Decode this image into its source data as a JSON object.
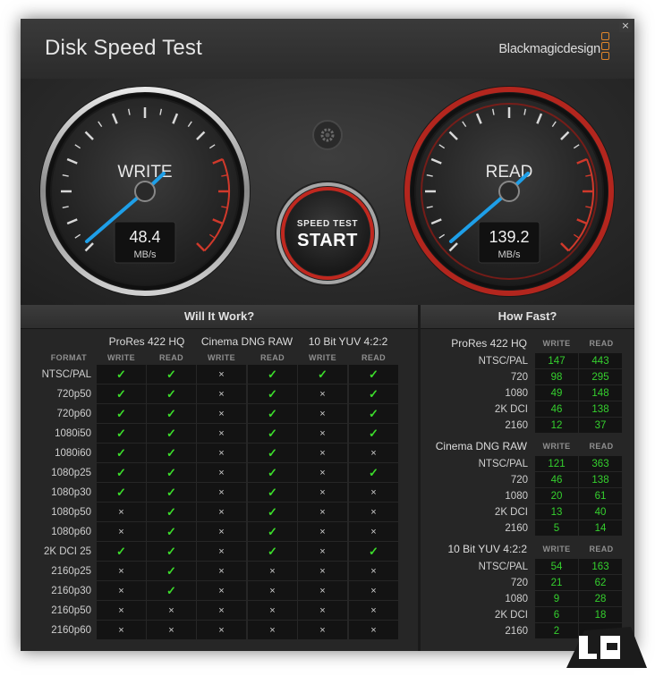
{
  "app": {
    "title": "Disk Speed Test",
    "brand": "Blackmagicdesign",
    "close_glyph": "×",
    "accent_color": "#e0852a"
  },
  "gauges": {
    "write": {
      "label": "WRITE",
      "value": "48.4",
      "unit": "MB/s"
    },
    "read": {
      "label": "READ",
      "value": "139.2",
      "unit": "MB/s"
    },
    "start_button": {
      "line1": "SPEED TEST",
      "line2": "START"
    },
    "settings_icon": "gear-icon"
  },
  "will_it_work": {
    "title": "Will It Work?",
    "format_label": "FORMAT",
    "codecs": [
      {
        "name": "ProRes 422 HQ",
        "write": "WRITE",
        "read": "READ"
      },
      {
        "name": "Cinema DNG RAW",
        "write": "WRITE",
        "read": "READ"
      },
      {
        "name": "10 Bit YUV 4:2:2",
        "write": "WRITE",
        "read": "READ"
      }
    ],
    "ok_glyph": "✓",
    "no_glyph": "×",
    "rows": [
      {
        "format": "NTSC/PAL",
        "support": [
          1,
          1,
          0,
          1,
          1,
          1
        ]
      },
      {
        "format": "720p50",
        "support": [
          1,
          1,
          0,
          1,
          0,
          1
        ]
      },
      {
        "format": "720p60",
        "support": [
          1,
          1,
          0,
          1,
          0,
          1
        ]
      },
      {
        "format": "1080i50",
        "support": [
          1,
          1,
          0,
          1,
          0,
          1
        ]
      },
      {
        "format": "1080i60",
        "support": [
          1,
          1,
          0,
          1,
          0,
          0
        ]
      },
      {
        "format": "1080p25",
        "support": [
          1,
          1,
          0,
          1,
          0,
          1
        ]
      },
      {
        "format": "1080p30",
        "support": [
          1,
          1,
          0,
          1,
          0,
          0
        ]
      },
      {
        "format": "1080p50",
        "support": [
          0,
          1,
          0,
          1,
          0,
          0
        ]
      },
      {
        "format": "1080p60",
        "support": [
          0,
          1,
          0,
          1,
          0,
          0
        ]
      },
      {
        "format": "2K DCI 25",
        "support": [
          1,
          1,
          0,
          1,
          0,
          1
        ]
      },
      {
        "format": "2160p25",
        "support": [
          0,
          1,
          0,
          0,
          0,
          0
        ]
      },
      {
        "format": "2160p30",
        "support": [
          0,
          1,
          0,
          0,
          0,
          0
        ]
      },
      {
        "format": "2160p50",
        "support": [
          0,
          0,
          0,
          0,
          0,
          0
        ]
      },
      {
        "format": "2160p60",
        "support": [
          0,
          0,
          0,
          0,
          0,
          0
        ]
      }
    ]
  },
  "how_fast": {
    "title": "How Fast?",
    "groups": [
      {
        "codec": "ProRes 422 HQ",
        "write": "WRITE",
        "read": "READ",
        "rows": [
          {
            "format": "NTSC/PAL",
            "write": "147",
            "read": "443"
          },
          {
            "format": "720",
            "write": "98",
            "read": "295"
          },
          {
            "format": "1080",
            "write": "49",
            "read": "148"
          },
          {
            "format": "2K DCI",
            "write": "46",
            "read": "138"
          },
          {
            "format": "2160",
            "write": "12",
            "read": "37"
          }
        ]
      },
      {
        "codec": "Cinema DNG RAW",
        "write": "WRITE",
        "read": "READ",
        "rows": [
          {
            "format": "NTSC/PAL",
            "write": "121",
            "read": "363"
          },
          {
            "format": "720",
            "write": "46",
            "read": "138"
          },
          {
            "format": "1080",
            "write": "20",
            "read": "61"
          },
          {
            "format": "2K DCI",
            "write": "13",
            "read": "40"
          },
          {
            "format": "2160",
            "write": "5",
            "read": "14"
          }
        ]
      },
      {
        "codec": "10 Bit YUV 4:2:2",
        "write": "WRITE",
        "read": "READ",
        "rows": [
          {
            "format": "NTSC/PAL",
            "write": "54",
            "read": "163"
          },
          {
            "format": "720",
            "write": "21",
            "read": "62"
          },
          {
            "format": "1080",
            "write": "9",
            "read": "28"
          },
          {
            "format": "2K DCI",
            "write": "6",
            "read": "18"
          },
          {
            "format": "2160",
            "write": "2",
            "read": ""
          }
        ]
      }
    ]
  },
  "colors": {
    "ok": "#3cdc2b",
    "number": "#35d02e",
    "needle": "#1e9fe8",
    "red_zone": "#d0392b"
  }
}
